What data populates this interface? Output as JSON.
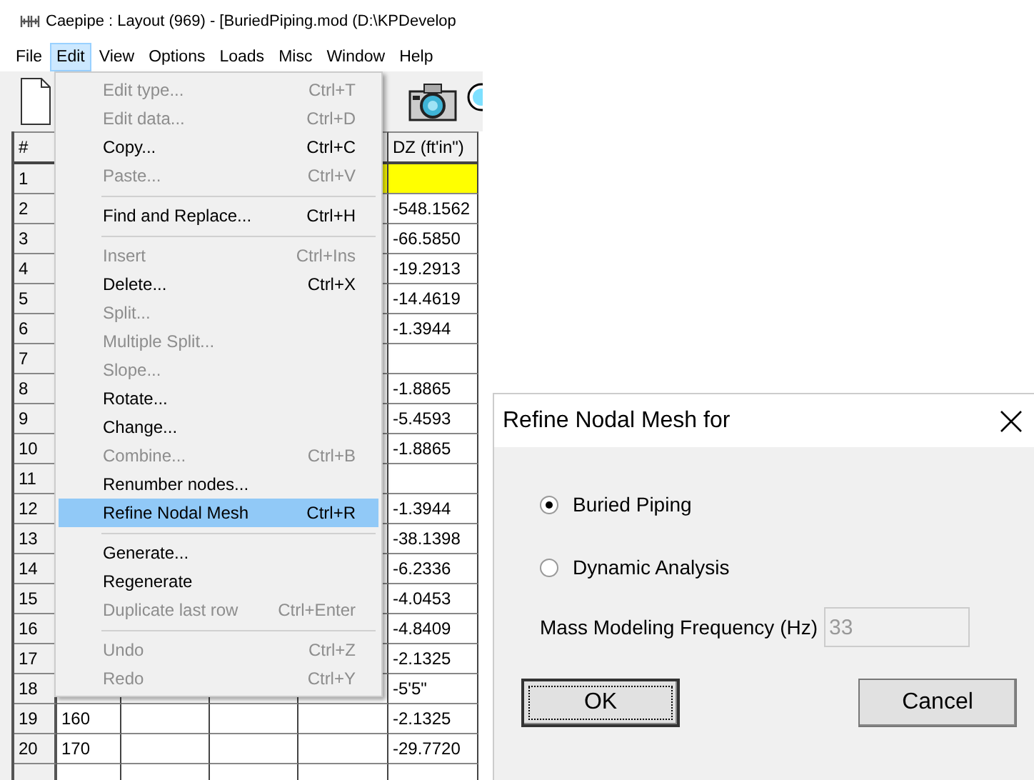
{
  "window": {
    "title": "Caepipe : Layout  (969)  -  [BuriedPiping.mod (D:\\KPDevelop"
  },
  "menubar": [
    {
      "label": "File",
      "selected": false
    },
    {
      "label": "Edit",
      "selected": true
    },
    {
      "label": "View",
      "selected": false
    },
    {
      "label": "Options",
      "selected": false
    },
    {
      "label": "Loads",
      "selected": false
    },
    {
      "label": "Misc",
      "selected": false
    },
    {
      "label": "Window",
      "selected": false
    },
    {
      "label": "Help",
      "selected": false
    }
  ],
  "table": {
    "header": {
      "number": "#",
      "dz": "DZ (ft'in\")"
    },
    "rows": [
      {
        "number": "1",
        "highlighted": true
      },
      {
        "number": "2",
        "highlighted": false,
        "dz": "-548.1562"
      },
      {
        "number": "3",
        "highlighted": false,
        "dz": "-66.5850"
      },
      {
        "number": "4",
        "highlighted": false,
        "dz": "-19.2913"
      },
      {
        "number": "5",
        "highlighted": false,
        "dz": "-14.4619"
      },
      {
        "number": "6",
        "highlighted": false,
        "dz": "-1.3944"
      },
      {
        "number": "7",
        "highlighted": false
      },
      {
        "number": "8",
        "highlighted": false,
        "dz": "-1.8865"
      },
      {
        "number": "9",
        "highlighted": false,
        "dz": "-5.4593"
      },
      {
        "number": "10",
        "highlighted": false,
        "dz": "-1.8865"
      },
      {
        "number": "11",
        "highlighted": false
      },
      {
        "number": "12",
        "highlighted": false,
        "dz": "-1.3944"
      },
      {
        "number": "13",
        "highlighted": false,
        "dz": "-38.1398"
      },
      {
        "number": "14",
        "highlighted": false,
        "dz": "-6.2336"
      },
      {
        "number": "15",
        "highlighted": false,
        "dz": "-4.0453"
      },
      {
        "number": "16",
        "highlighted": false,
        "dz": "-4.8409"
      },
      {
        "number": "17",
        "highlighted": false,
        "dz": "-2.1325"
      },
      {
        "number": "18",
        "highlighted": false,
        "dz": "-5'5\""
      },
      {
        "number": "19",
        "highlighted": false,
        "column_2": "160",
        "dz": "-2.1325"
      },
      {
        "number": "20",
        "highlighted": false,
        "column_2": "170",
        "dz": "-29.7720"
      }
    ]
  },
  "menu": {
    "items": [
      {
        "kind": "item",
        "label": "Edit type...",
        "shortcut": "Ctrl+T",
        "disabled": true,
        "selected": false
      },
      {
        "kind": "item",
        "label": "Edit data...",
        "shortcut": "Ctrl+D",
        "disabled": true,
        "selected": false
      },
      {
        "kind": "item",
        "label": "Copy...",
        "shortcut": "Ctrl+C",
        "disabled": false,
        "selected": false
      },
      {
        "kind": "item",
        "label": "Paste...",
        "shortcut": "Ctrl+V",
        "disabled": true,
        "selected": false
      },
      {
        "kind": "separator"
      },
      {
        "kind": "item",
        "label": "Find and Replace...",
        "shortcut": "Ctrl+H",
        "disabled": false,
        "selected": false
      },
      {
        "kind": "separator"
      },
      {
        "kind": "item",
        "label": "Insert",
        "shortcut": "Ctrl+Ins",
        "disabled": true,
        "selected": false
      },
      {
        "kind": "item",
        "label": "Delete...",
        "shortcut": "Ctrl+X",
        "disabled": false,
        "selected": false
      },
      {
        "kind": "item",
        "label": "Split...",
        "disabled": true,
        "selected": false
      },
      {
        "kind": "item",
        "label": "Multiple Split...",
        "disabled": true,
        "selected": false
      },
      {
        "kind": "item",
        "label": "Slope...",
        "disabled": true,
        "selected": false
      },
      {
        "kind": "item",
        "label": "Rotate...",
        "disabled": false,
        "selected": false
      },
      {
        "kind": "item",
        "label": "Change...",
        "disabled": false,
        "selected": false
      },
      {
        "kind": "item",
        "label": "Combine...",
        "shortcut": "Ctrl+B",
        "disabled": true,
        "selected": false
      },
      {
        "kind": "item",
        "label": "Renumber nodes...",
        "disabled": false,
        "selected": false
      },
      {
        "kind": "item",
        "label": "Refine Nodal Mesh",
        "shortcut": "Ctrl+R",
        "disabled": false,
        "selected": true
      },
      {
        "kind": "separator"
      },
      {
        "kind": "item",
        "label": "Generate...",
        "disabled": false,
        "selected": false
      },
      {
        "kind": "item",
        "label": "Regenerate",
        "disabled": false,
        "selected": false
      },
      {
        "kind": "item",
        "label": "Duplicate last row",
        "shortcut": "Ctrl+Enter",
        "disabled": true,
        "selected": false
      },
      {
        "kind": "separator"
      },
      {
        "kind": "item",
        "label": "Undo",
        "shortcut": "Ctrl+Z",
        "disabled": true,
        "selected": false
      },
      {
        "kind": "item",
        "label": "Redo",
        "shortcut": "Ctrl+Y",
        "disabled": true,
        "selected": false
      }
    ]
  },
  "dialog": {
    "title": "Refine Nodal Mesh for",
    "options": [
      {
        "label": "Buried Piping",
        "selected": true
      },
      {
        "label": "Dynamic Analysis",
        "selected": false
      }
    ],
    "frequency": {
      "label": "Mass Modeling Frequency (Hz)",
      "value": "33",
      "disabled": true
    },
    "buttons": [
      {
        "label": "OK",
        "focused": true
      },
      {
        "label": "Cancel",
        "focused": false
      }
    ]
  }
}
